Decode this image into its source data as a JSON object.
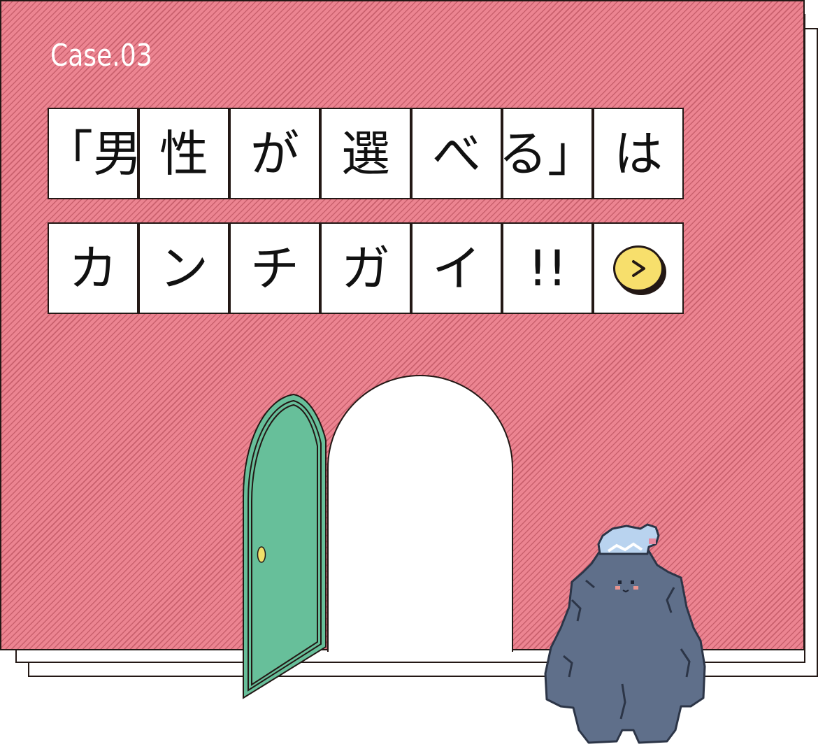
{
  "case_label": "Case.03",
  "headline": {
    "line1": [
      "「男",
      "性",
      "が",
      "選",
      "べ",
      "る」",
      "は"
    ],
    "line2": [
      "カ",
      "ン",
      "チ",
      "ガ",
      "イ",
      "!!"
    ]
  },
  "next_button": {
    "icon": "chevron-right-icon",
    "glyph": ">"
  },
  "colors": {
    "wall": "#ec8491",
    "wall_stripe": "#c9606d",
    "door": "#67bf9a",
    "door_knob": "#f0e06a",
    "button": "#f7df6c",
    "creature": "#5f6f8a",
    "creature_hat": "#b9d3ef",
    "outline": "#231815"
  }
}
